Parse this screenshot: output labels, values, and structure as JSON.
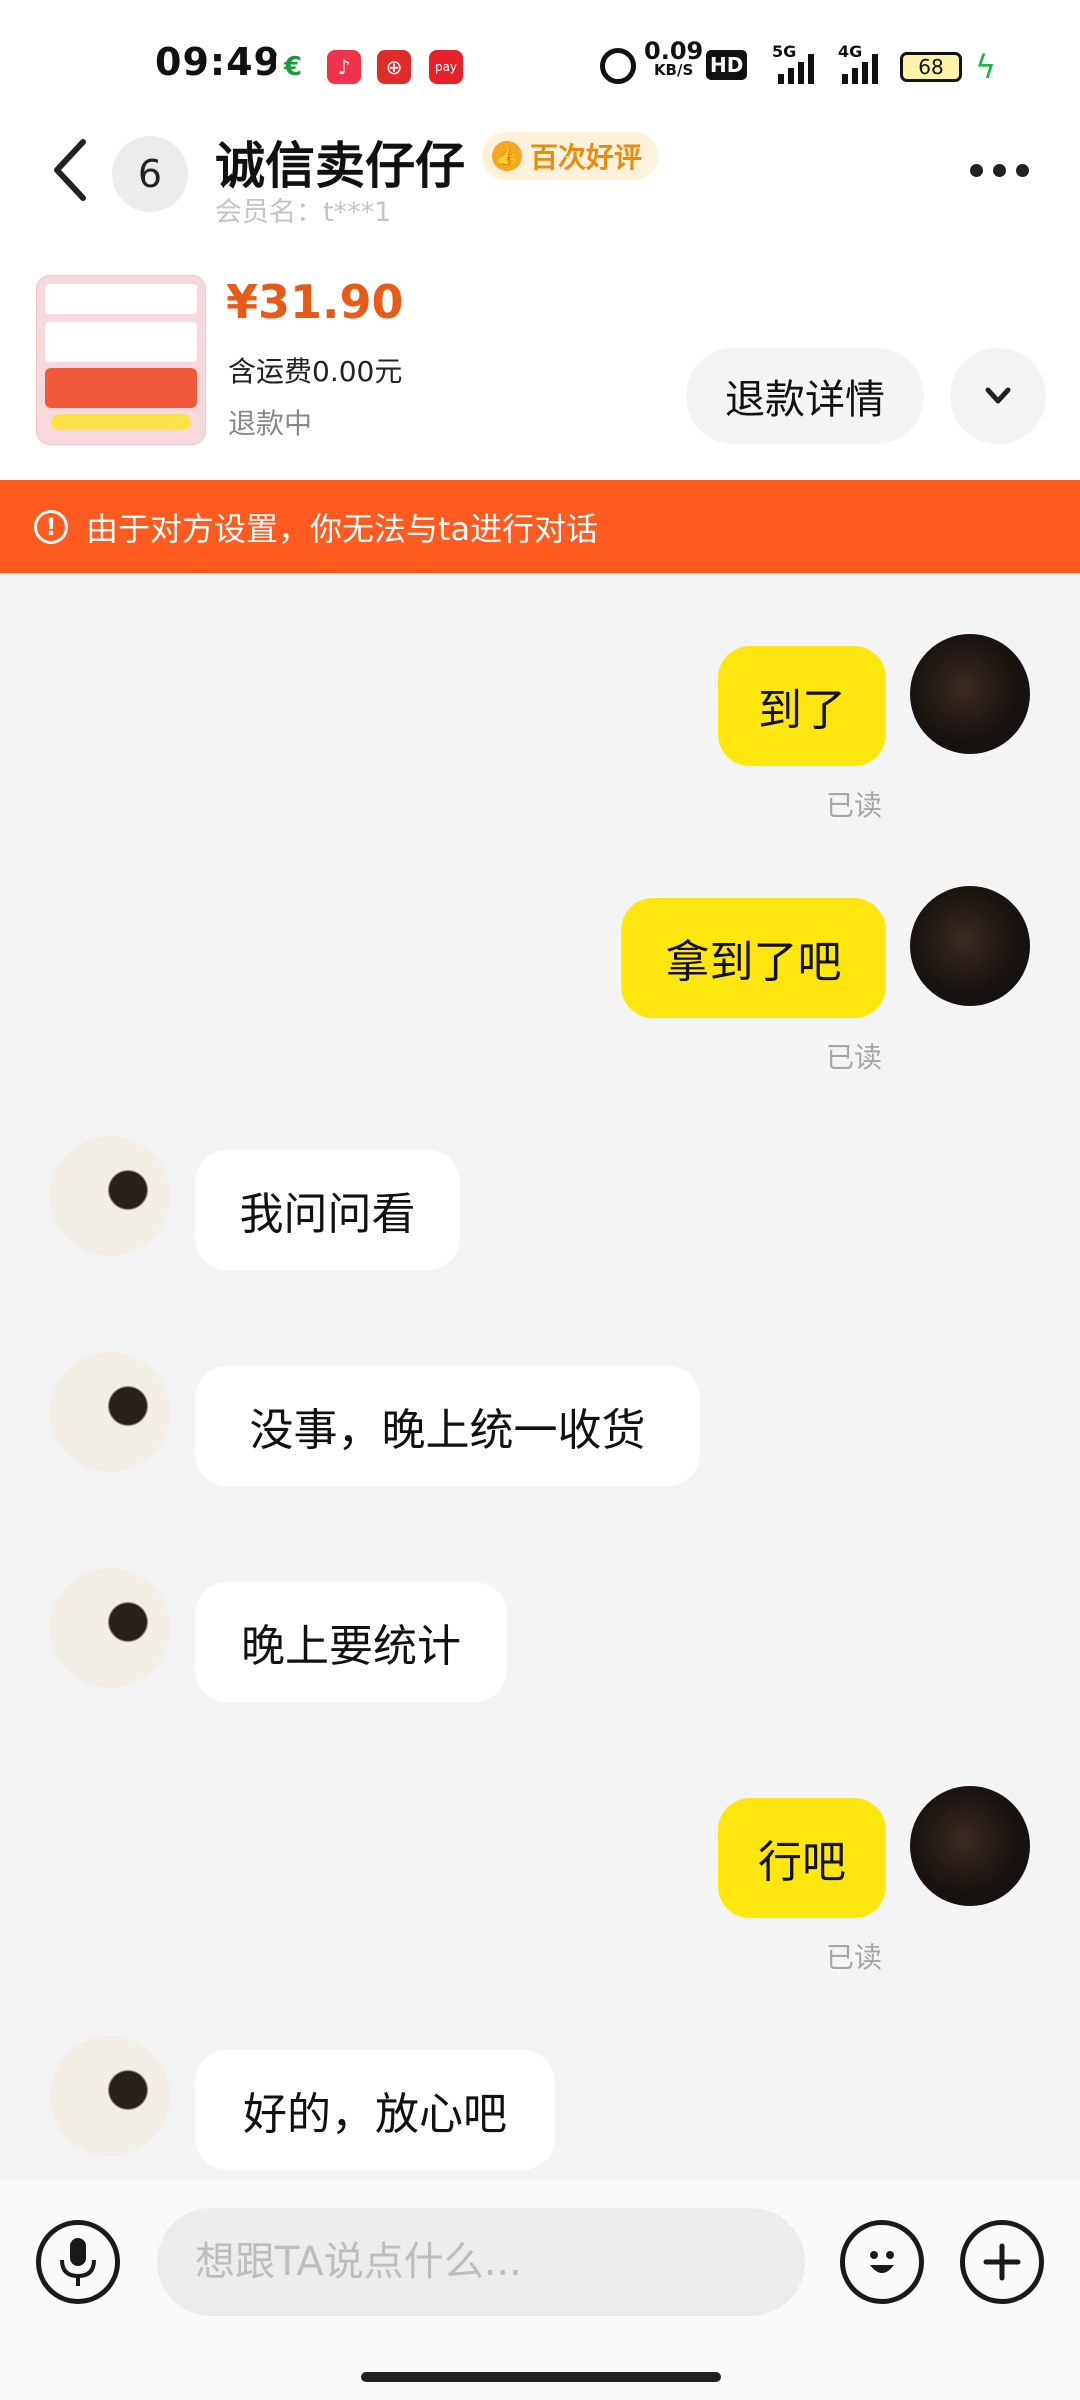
{
  "status_bar": {
    "time": "09:49",
    "net_speed_value": "0.09",
    "net_speed_unit": "KB/S",
    "hd_label": "HD",
    "signal_1": "5G",
    "signal_2": "4G",
    "battery": "68",
    "app_icons": [
      "postal-app-icon",
      "music-app-icon",
      "bank-app-icon",
      "pay-app-icon"
    ]
  },
  "header": {
    "back_icon": "chevron-left-icon",
    "unread_count": "6",
    "shop_name": "诚信卖仔仔",
    "rating_badge": "百次好评",
    "member_name": "会员名：t***1",
    "more_icon": "more-dots-icon"
  },
  "product": {
    "price": "¥31.90",
    "shipping": "含运费0.00元",
    "status": "退款中",
    "refund_detail_label": "退款详情",
    "expand_icon": "chevron-down-icon"
  },
  "warning": {
    "text": "由于对方设置，你无法与ta进行对话"
  },
  "messages": [
    {
      "sender": "me",
      "text": "到了",
      "read": "已读"
    },
    {
      "sender": "me",
      "text": "拿到了吧",
      "read": "已读"
    },
    {
      "sender": "other",
      "text": "我问问看"
    },
    {
      "sender": "other",
      "text": "没事，晚上统一收货"
    },
    {
      "sender": "other",
      "text": "晚上要统计"
    },
    {
      "sender": "me",
      "text": "行吧",
      "read": "已读"
    },
    {
      "sender": "other",
      "text": "好的，放心吧"
    }
  ],
  "input_bar": {
    "placeholder": "想跟TA说点什么...",
    "voice_icon": "microphone-icon",
    "emoji_icon": "emoji-icon",
    "plus_icon": "plus-icon"
  },
  "colors": {
    "accent_yellow": "#ffe60f",
    "warning_orange": "#ff5a1f",
    "price_orange": "#e85a17"
  }
}
